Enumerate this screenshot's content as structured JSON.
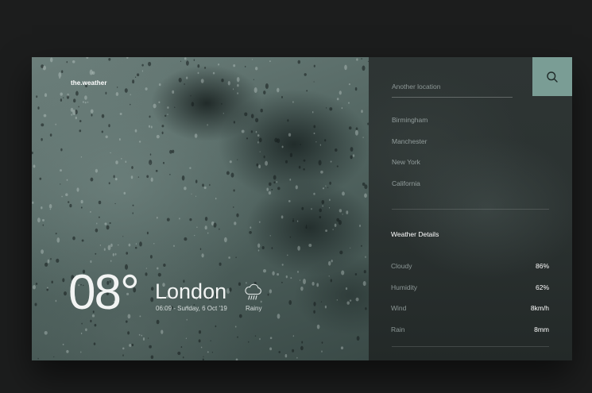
{
  "brand": "the.weather",
  "current": {
    "temperature": "08°",
    "city": "London",
    "datetime": "06:09 - Sunday, 6 Oct '19",
    "condition": "Rainy",
    "condition_icon": "rain-cloud-icon"
  },
  "search": {
    "placeholder": "Another location",
    "button_icon": "search-icon"
  },
  "locations": [
    "Birmingham",
    "Manchester",
    "New York",
    "California"
  ],
  "details": {
    "title": "Weather Details",
    "rows": [
      {
        "label": "Cloudy",
        "value": "86%"
      },
      {
        "label": "Humidity",
        "value": "62%"
      },
      {
        "label": "Wind",
        "value": "8km/h"
      },
      {
        "label": "Rain",
        "value": "8mm"
      }
    ]
  },
  "colors": {
    "accent": "#7a9d95",
    "page_background": "#1c1d1d",
    "panel_background": "#2b3231"
  }
}
